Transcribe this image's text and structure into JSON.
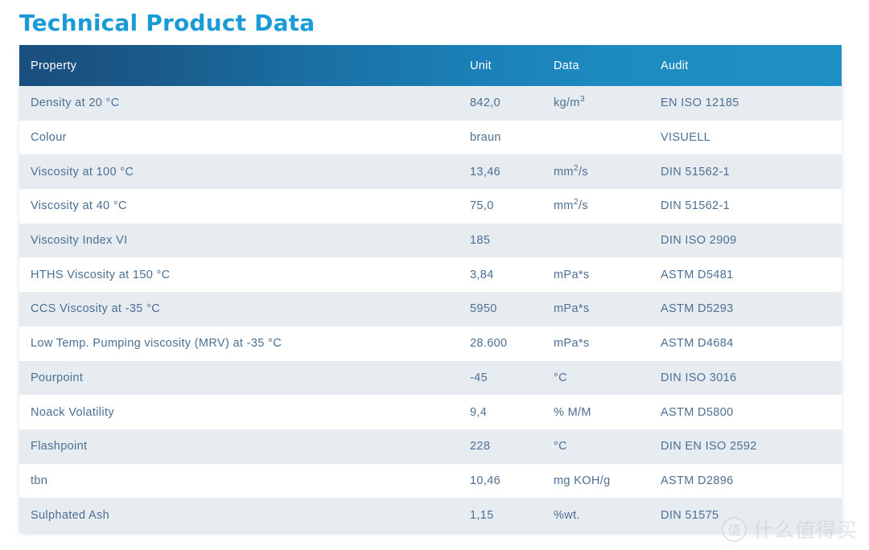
{
  "page": {
    "title": "Technical Product Data"
  },
  "table": {
    "columns": [
      {
        "key": "property",
        "label": "Property"
      },
      {
        "key": "value",
        "label": "Unit"
      },
      {
        "key": "unit",
        "label": "Data"
      },
      {
        "key": "audit",
        "label": "Audit"
      }
    ],
    "rows": [
      {
        "property": "Density at 20 °C",
        "value": "842,0",
        "unit": "kg/m³",
        "audit": "EN ISO 12185"
      },
      {
        "property": "Colour",
        "value": "braun",
        "unit": "",
        "audit": "VISUELL"
      },
      {
        "property": "Viscosity at 100 °C",
        "value": "13,46",
        "unit": "mm²/s",
        "audit": "DIN 51562-1"
      },
      {
        "property": "Viscosity at 40 °C",
        "value": "75,0",
        "unit": "mm²/s",
        "audit": "DIN 51562-1"
      },
      {
        "property": "Viscosity Index VI",
        "value": "185",
        "unit": "",
        "audit": "DIN ISO 2909"
      },
      {
        "property": "HTHS Viscosity at 150 °C",
        "value": "3,84",
        "unit": "mPa*s",
        "audit": "ASTM D5481"
      },
      {
        "property": "CCS Viscosity at -35 °C",
        "value": "5950",
        "unit": "mPa*s",
        "audit": "ASTM D5293"
      },
      {
        "property": "Low Temp. Pumping viscosity (MRV) at -35 °C",
        "value": "28.600",
        "unit": "mPa*s",
        "audit": "ASTM D4684"
      },
      {
        "property": "Pourpoint",
        "value": "-45",
        "unit": "°C",
        "audit": "DIN ISO 3016"
      },
      {
        "property": "Noack Volatility",
        "value": "9,4",
        "unit": "% M/M",
        "audit": "ASTM D5800"
      },
      {
        "property": "Flashpoint",
        "value": "228",
        "unit": "°C",
        "audit": "DIN EN ISO 2592"
      },
      {
        "property": "tbn",
        "value": "10,46",
        "unit": "mg KOH/g",
        "audit": "ASTM D2896"
      },
      {
        "property": "Sulphated Ash",
        "value": "1,15",
        "unit": "%wt.",
        "audit": "DIN 51575"
      }
    ]
  },
  "watermark": {
    "badge": "值",
    "text": "什么值得买"
  },
  "colors": {
    "title": "#1a9bd7",
    "header_gradient_start": "#1a4e7e",
    "header_gradient_end": "#1e8fc4",
    "row_odd": "#e7ecf0",
    "row_even": "#ffffff",
    "text": "#4d6f94"
  }
}
